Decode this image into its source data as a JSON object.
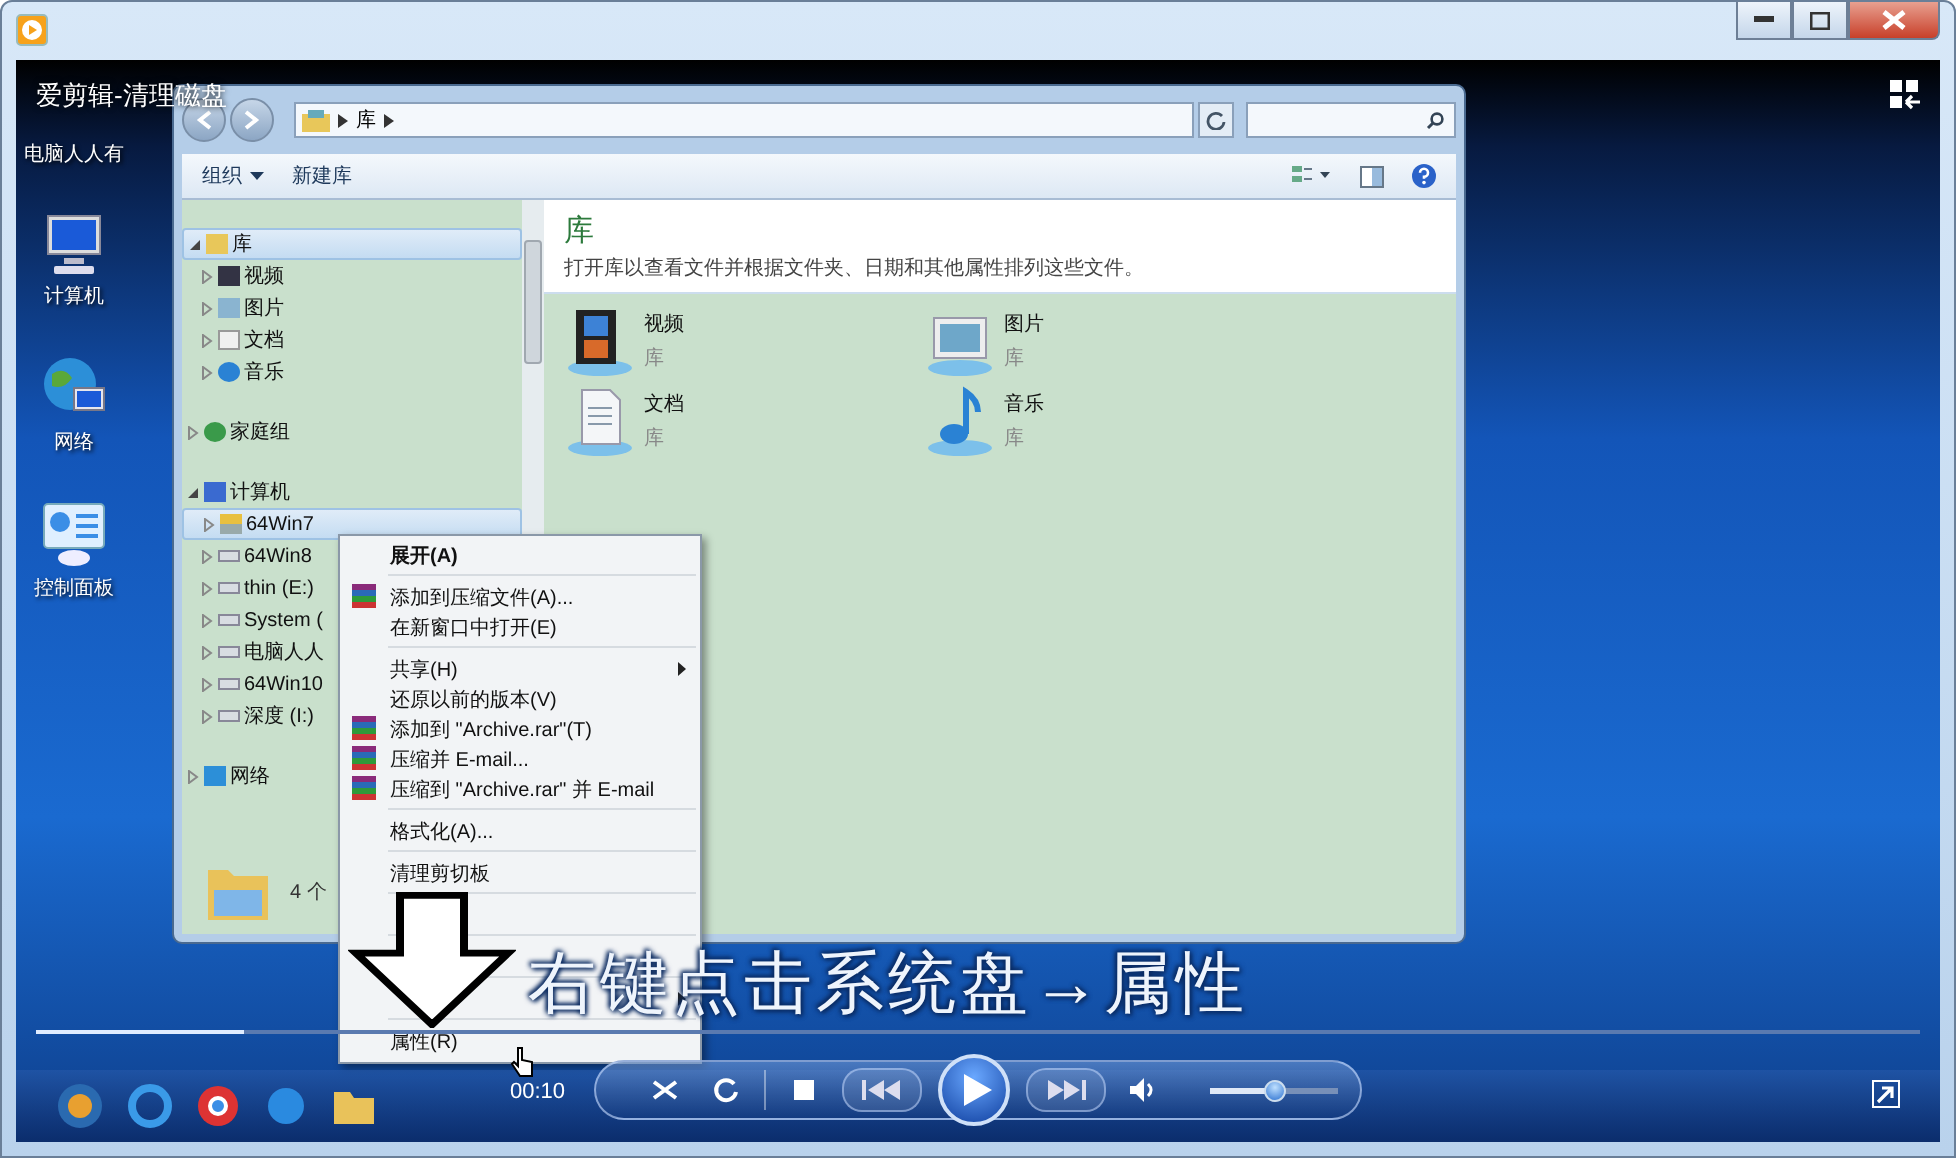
{
  "video": {
    "title": "爱剪辑-清理磁盘",
    "subtitle": "右键点击系统盘→属性"
  },
  "desktop_icons": [
    {
      "label": "电脑人人有",
      "kind": "logo"
    },
    {
      "label": "计算机",
      "kind": "computer"
    },
    {
      "label": "网络",
      "kind": "network"
    },
    {
      "label": "控制面板",
      "kind": "control-panel"
    }
  ],
  "explorer": {
    "breadcrumb": "库",
    "toolbar": [
      {
        "label": "组织",
        "dropdown": true
      },
      {
        "label": "新建库",
        "dropdown": false
      }
    ],
    "nav": [
      {
        "label": "库",
        "kind": "library",
        "expanded": true,
        "selected": true,
        "children": [
          {
            "label": "视频",
            "kind": "video",
            "selected": false
          },
          {
            "label": "图片",
            "kind": "picture",
            "selected": false
          },
          {
            "label": "文档",
            "kind": "document",
            "selected": false
          },
          {
            "label": "音乐",
            "kind": "music",
            "selected": false
          }
        ]
      },
      {
        "label": "家庭组",
        "kind": "homegroup",
        "expanded": false,
        "selected": false
      },
      {
        "label": "计算机",
        "kind": "computer",
        "expanded": true,
        "selected": false,
        "children": [
          {
            "label": "64Win7",
            "kind": "system-drive",
            "selected": true
          },
          {
            "label": "64Win8",
            "kind": "drive",
            "selected": false
          },
          {
            "label": "thin (E:)",
            "kind": "drive",
            "selected": false
          },
          {
            "label": "System (",
            "kind": "drive",
            "selected": false
          },
          {
            "label": "电脑人人",
            "kind": "drive",
            "selected": false
          },
          {
            "label": "64Win10",
            "kind": "drive",
            "selected": false
          },
          {
            "label": "深度 (I:)",
            "kind": "drive",
            "selected": false
          }
        ]
      },
      {
        "label": "网络",
        "kind": "network",
        "expanded": false,
        "selected": false
      }
    ],
    "status": "4 个",
    "heading": "库",
    "description": "打开库以查看文件并根据文件夹、日期和其他属性排列这些文件。",
    "libraries": [
      {
        "name": "视频",
        "type": "库",
        "kind": "video"
      },
      {
        "name": "图片",
        "type": "库",
        "kind": "picture"
      },
      {
        "name": "文档",
        "type": "库",
        "kind": "document"
      },
      {
        "name": "音乐",
        "type": "库",
        "kind": "music"
      }
    ]
  },
  "context_menu": [
    {
      "kind": "item",
      "label": "展开(A)",
      "bold": true,
      "rar": false,
      "submenu": false
    },
    {
      "kind": "separator"
    },
    {
      "kind": "item",
      "label": "添加到压缩文件(A)...",
      "bold": false,
      "rar": true,
      "submenu": false
    },
    {
      "kind": "item",
      "label": "在新窗口中打开(E)",
      "bold": false,
      "rar": false,
      "submenu": false
    },
    {
      "kind": "separator"
    },
    {
      "kind": "item",
      "label": "共享(H)",
      "bold": false,
      "rar": false,
      "submenu": true
    },
    {
      "kind": "item",
      "label": "还原以前的版本(V)",
      "bold": false,
      "rar": false,
      "submenu": false
    },
    {
      "kind": "item",
      "label": "添加到 \"Archive.rar\"(T)",
      "bold": false,
      "rar": true,
      "submenu": false
    },
    {
      "kind": "item",
      "label": "压缩并 E-mail...",
      "bold": false,
      "rar": true,
      "submenu": false
    },
    {
      "kind": "item",
      "label": "压缩到 \"Archive.rar\" 并 E-mail",
      "bold": false,
      "rar": true,
      "submenu": false
    },
    {
      "kind": "separator"
    },
    {
      "kind": "item",
      "label": "格式化(A)...",
      "bold": false,
      "rar": false,
      "submenu": false
    },
    {
      "kind": "separator"
    },
    {
      "kind": "item",
      "label": "清理剪切板",
      "bold": false,
      "rar": false,
      "submenu": false
    },
    {
      "kind": "separator"
    },
    {
      "kind": "obscured"
    },
    {
      "kind": "separator"
    },
    {
      "kind": "obscured"
    },
    {
      "kind": "separator"
    },
    {
      "kind": "obscured",
      "submenu": true
    },
    {
      "kind": "separator"
    },
    {
      "kind": "item",
      "label": "属性(R)",
      "bold": false,
      "rar": false,
      "submenu": false
    }
  ],
  "player": {
    "time": "00:10",
    "progress": {
      "level": 0.11
    },
    "volume": {
      "level": 0.5
    },
    "playing": false
  }
}
